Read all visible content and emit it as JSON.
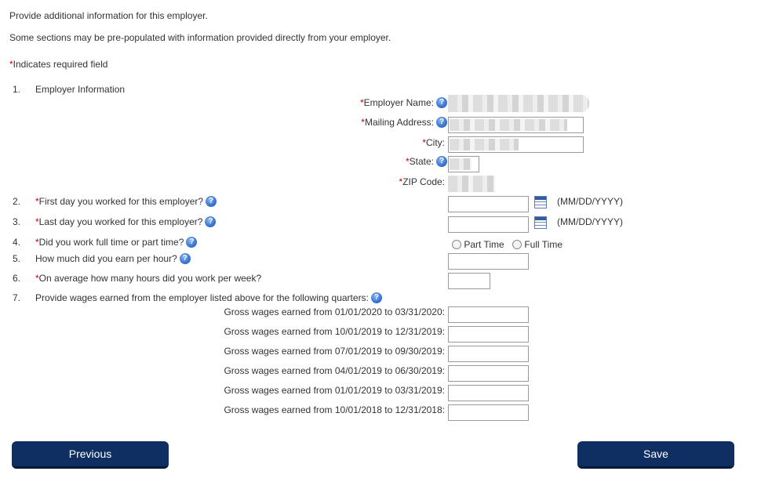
{
  "intro": {
    "line1": "Provide additional information for this employer.",
    "line2": "Some sections may be pre-populated with information provided directly from your employer.",
    "required_marker": "*",
    "required_note": "Indicates required field"
  },
  "section1": {
    "number": "1.",
    "title": "Employer Information",
    "fields": {
      "employer_name": "Employer Name:",
      "mailing_address": "Mailing Address:",
      "city": "City:",
      "state": "State:",
      "zip": "ZIP Code:"
    }
  },
  "questions": {
    "q2": {
      "number": "2.",
      "label": "First day you worked for this employer?",
      "hint": "(MM/DD/YYYY)"
    },
    "q3": {
      "number": "3.",
      "label": "Last day you worked for this employer?",
      "hint": "(MM/DD/YYYY)"
    },
    "q4": {
      "number": "4.",
      "label": "Did you work full time or part time?",
      "options": [
        "Part Time",
        "Full Time"
      ]
    },
    "q5": {
      "number": "5.",
      "label": "How much did you earn per hour?"
    },
    "q6": {
      "number": "6.",
      "label": "On average how many hours did you work per week?"
    },
    "q7": {
      "number": "7.",
      "label": "Provide wages earned from the employer listed above for the following quarters:"
    }
  },
  "wages": [
    "Gross wages earned from 01/01/2020 to 03/31/2020:",
    "Gross wages earned from 10/01/2019 to 12/31/2019:",
    "Gross wages earned from 07/01/2019 to 09/30/2019:",
    "Gross wages earned from 04/01/2019 to 06/30/2019:",
    "Gross wages earned from 01/01/2019 to 03/31/2019:",
    "Gross wages earned from 10/01/2018 to 12/31/2018:"
  ],
  "buttons": {
    "previous": "Previous",
    "save": "Save"
  },
  "help_glyph": "?",
  "colors": {
    "button_bg": "#0f2f63",
    "required": "#cc0000",
    "help_icon": "#3c79d4"
  }
}
